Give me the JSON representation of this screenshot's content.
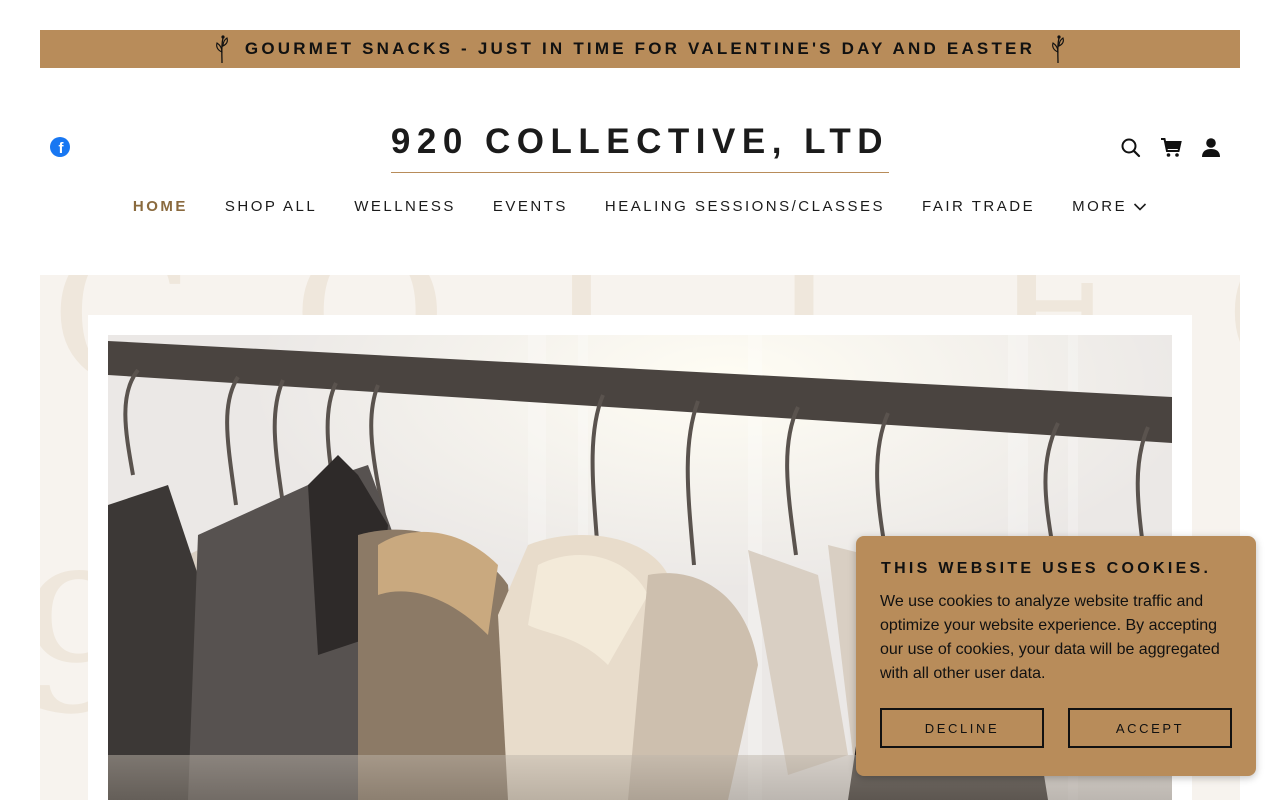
{
  "banner": {
    "text": "GOURMET SNACKS - JUST IN TIME FOR VALENTINE'S DAY AND EASTER",
    "icon": "sprig-icon"
  },
  "header": {
    "site_title": "920 COLLECTIVE, LTD",
    "social": {
      "icon": "facebook-icon",
      "glyph": "f"
    },
    "icons": [
      "search-icon",
      "cart-icon",
      "account-icon"
    ]
  },
  "nav": {
    "items": [
      {
        "label": "HOME",
        "active": true
      },
      {
        "label": "SHOP ALL",
        "active": false
      },
      {
        "label": "WELLNESS",
        "active": false
      },
      {
        "label": "EVENTS",
        "active": false
      },
      {
        "label": "HEALING SESSIONS/CLASSES",
        "active": false
      },
      {
        "label": "FAIR TRADE",
        "active": false
      },
      {
        "label": "MORE",
        "active": false
      }
    ]
  },
  "hero": {
    "image": "clothing rack with wooden hangers in soft sunlight"
  },
  "cookie": {
    "title": "THIS WEBSITE USES COOKIES.",
    "body": "We use cookies to analyze website traffic and optimize your website experience. By accepting our use of cookies, your data will be aggregated with all other user data.",
    "decline_label": "DECLINE",
    "accept_label": "ACCEPT"
  },
  "colors": {
    "accent": "#b88c5a",
    "active_nav": "#8a6a3e",
    "facebook": "#1877f2",
    "hero_bg": "#f7f3ee"
  }
}
